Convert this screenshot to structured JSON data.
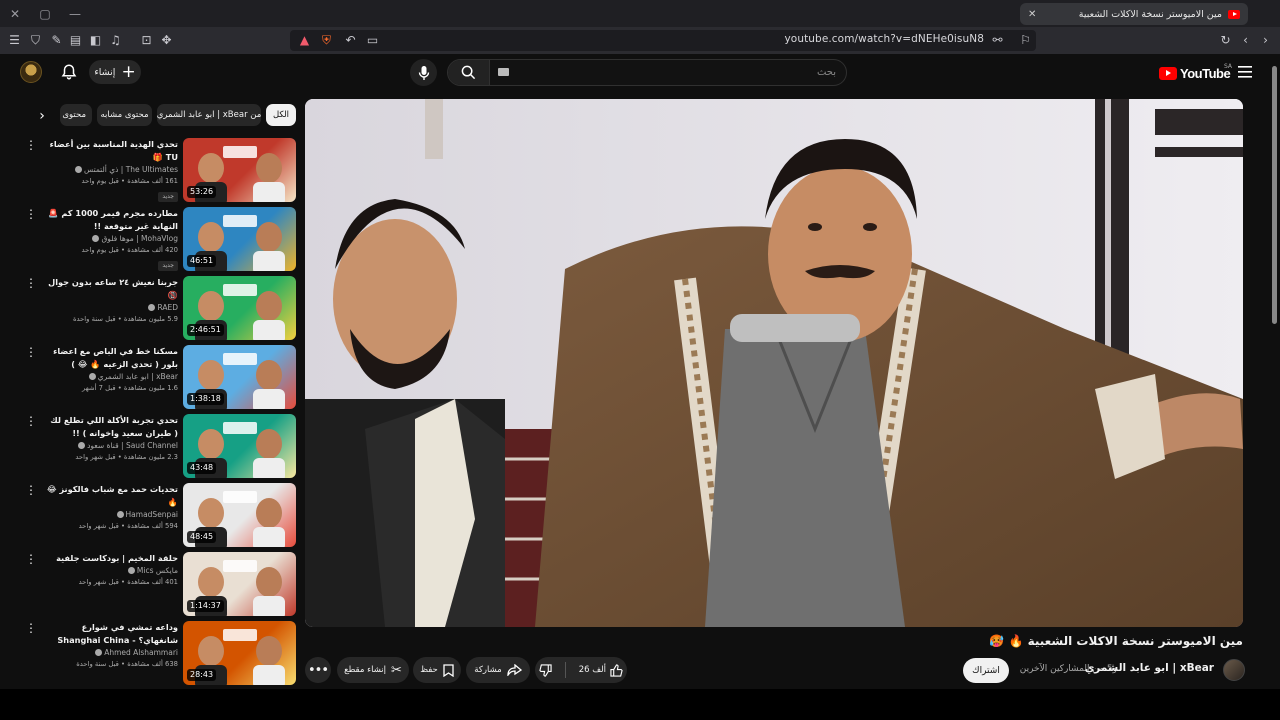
{
  "browser": {
    "tab_title": "مين الاميوستر نسخة الاكلات الشعبية",
    "url": "youtube.com/watch?v=dNEHe0isuN8"
  },
  "header": {
    "create_label": "إنشاء",
    "search_placeholder": "بحث",
    "logo_text": "YouTube",
    "region": "SA"
  },
  "chips": [
    {
      "label": "الكل",
      "active": true
    },
    {
      "label": "من xBear | ابو عابد الشمري",
      "active": false
    },
    {
      "label": "محتوى مشابه",
      "active": false
    },
    {
      "label": "محتوى",
      "active": false
    }
  ],
  "video": {
    "title": "مين الاميوستر نسخة الاكلات الشعبية 🔥 🥵",
    "channel": "xBear | ابو عابد الشمري",
    "collab": "و5 من المشاركين الآخرين",
    "subscribe_label": "اشتراك",
    "likes": "26 ألف",
    "share_label": "مشاركة",
    "save_label": "حفظ",
    "clip_label": "إنشاء مقطع"
  },
  "recommendations": [
    {
      "title": "تحدي الهدية المناسبة بين أعضاء TU 🎁",
      "channel": "The Ultimates | ذي ألتمتس",
      "meta": "161 ألف مشاهدة • قبل يوم واحد",
      "badge": "جديد",
      "duration": "53:26"
    },
    {
      "title": "مطارده مجرم قيمر 1000 كم 🚨 النهاية غير متوقعة !!",
      "channel": "MohaVlog | موها فلوق",
      "meta": "420 ألف مشاهدة • قبل يوم واحد",
      "badge": "جديد",
      "duration": "46:51"
    },
    {
      "title": "جربنا نعيش ٢٤ ساعه بدون جوال 📵",
      "channel": "RAED",
      "meta": "5.9 مليون مشاهدة • قبل سنة واحدة",
      "badge": "",
      "duration": "2:46:51"
    },
    {
      "title": "مسكنا خط في الباص مع اعضاء بلور ( تحدي الزعيه 🔥 😂 )",
      "channel": "xBear | ابو عابد الشمري",
      "meta": "1.6 مليون مشاهدة • قبل 7 أشهر",
      "badge": "",
      "duration": "1:38:18"
    },
    {
      "title": "تحدي تجربة الأكلة اللي تطلع لك ( طيران سعيد واخوانه ) !!",
      "channel": "Saud Channel | قناة سعود",
      "meta": "2.3 مليون مشاهدة • قبل شهر واحد",
      "badge": "",
      "duration": "43:48"
    },
    {
      "title": "تحديات حمد مع شباب فالكونز 😂 🔥",
      "channel": "HamadSenpai",
      "meta": "594 ألف مشاهدة • قبل شهر واحد",
      "badge": "",
      "duration": "48:45"
    },
    {
      "title": "حلقة المخيم | بودكاست جلفية",
      "channel": "مايكس Mics",
      "meta": "401 ألف مشاهدة • قبل شهر واحد",
      "badge": "",
      "duration": "1:14:37"
    },
    {
      "title": "وداعه تمشي في شوارع شانغهاي؟ - Shanghai China 🇨🇳",
      "channel": "Ahmed Alshammari",
      "meta": "638 ألف مشاهدة • قبل سنة واحدة",
      "badge": "",
      "duration": "28:43"
    }
  ],
  "colors": {
    "background": "#0f0f0f",
    "brand_red": "#ff0000",
    "pill": "#272727"
  }
}
